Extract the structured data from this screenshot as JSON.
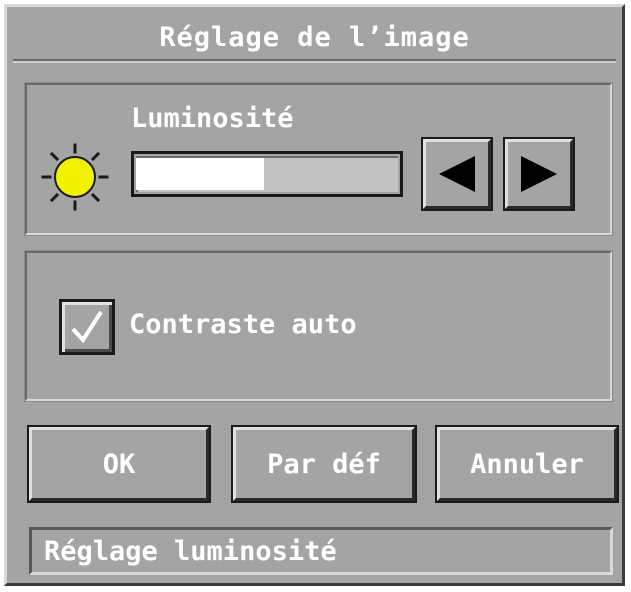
{
  "window": {
    "title": "Réglage de l’image"
  },
  "brightness": {
    "label": "Luminosité",
    "level_percent": 49,
    "icon": "sun-icon",
    "decrease_icon": "triangle-left-icon",
    "increase_icon": "triangle-right-icon"
  },
  "contrast": {
    "label": "Contraste auto",
    "checked": true,
    "icon": "checkmark-icon"
  },
  "buttons": {
    "ok": "OK",
    "defaults": "Par déf",
    "cancel": "Annuler"
  },
  "status": {
    "text": "Réglage luminosité"
  },
  "colors": {
    "face": "#a4a4a4",
    "sun": "#f2f200",
    "text": "#ffffff"
  }
}
